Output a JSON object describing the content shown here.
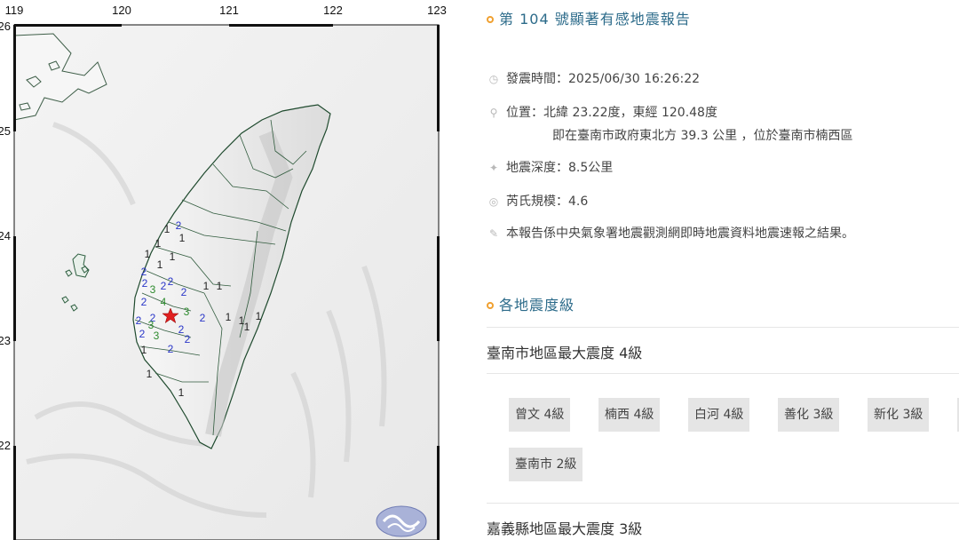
{
  "map": {
    "lon_labels": [
      "119",
      "120",
      "121",
      "122",
      "123"
    ],
    "lat_labels": [
      "26",
      "25",
      "24",
      "23",
      "22"
    ],
    "epicenter_symbol": "star",
    "intensity_marks": [
      {
        "v": "2",
        "c": "#2a36c8"
      },
      {
        "v": "1",
        "c": "#222"
      },
      {
        "v": "1",
        "c": "#222"
      },
      {
        "v": "1",
        "c": "#222"
      },
      {
        "v": "1",
        "c": "#222"
      },
      {
        "v": "1",
        "c": "#222"
      },
      {
        "v": "1",
        "c": "#222"
      },
      {
        "v": "2",
        "c": "#2a36c8"
      },
      {
        "v": "2",
        "c": "#2a36c8"
      },
      {
        "v": "2",
        "c": "#2a36c8"
      },
      {
        "v": "3",
        "c": "#2e8b2e"
      },
      {
        "v": "2",
        "c": "#2a36c8"
      },
      {
        "v": "2",
        "c": "#2a36c8"
      },
      {
        "v": "1",
        "c": "#222"
      },
      {
        "v": "1",
        "c": "#222"
      },
      {
        "v": "2",
        "c": "#2a36c8"
      },
      {
        "v": "4",
        "c": "#2e8b2e"
      },
      {
        "v": "2",
        "c": "#2a36c8"
      },
      {
        "v": "3",
        "c": "#2e8b2e"
      },
      {
        "v": "2",
        "c": "#2a36c8"
      },
      {
        "v": "3",
        "c": "#2e8b2e"
      },
      {
        "v": "2",
        "c": "#2a36c8"
      },
      {
        "v": "2",
        "c": "#2a36c8"
      },
      {
        "v": "3",
        "c": "#2e8b2e"
      },
      {
        "v": "2",
        "c": "#2a36c8"
      },
      {
        "v": "2",
        "c": "#2a36c8"
      },
      {
        "v": "1",
        "c": "#222"
      },
      {
        "v": "2",
        "c": "#2a36c8"
      },
      {
        "v": "1",
        "c": "#222"
      },
      {
        "v": "1",
        "c": "#222"
      },
      {
        "v": "1",
        "c": "#222"
      },
      {
        "v": "1",
        "c": "#222"
      },
      {
        "v": "1",
        "c": "#222"
      },
      {
        "v": "1",
        "c": "#222"
      }
    ]
  },
  "report": {
    "title": "第 104 號顯著有感地震報告",
    "origin_time": "發震時間：2025/06/30 16:26:22",
    "location": "位置：北緯 23.22度，東經 120.48度",
    "location_detail": "即在臺南市政府東北方 39.3 公里 ，位於臺南市楠西區",
    "depth": "地震深度：8.5公里",
    "magnitude": "芮氏規模：4.6",
    "note": "本報告係中央氣象署地震觀測網即時地震資料地震速報之結果。"
  },
  "intensity_section": {
    "title": "各地震度級",
    "regions": [
      {
        "heading": "臺南市地區最大震度 4級",
        "stations": [
          "曾文 4級",
          "楠西 4級",
          "白河 4級",
          "善化 3級",
          "新化 3級",
          "",
          "臺南市 2級"
        ]
      },
      {
        "heading": "嘉義縣地區最大震度 3級"
      }
    ]
  },
  "colors": {
    "title_blue": "#2c6b8a",
    "bullet_orange": "#f0a030",
    "intensity_1": "#222222",
    "intensity_2": "#2a36c8",
    "intensity_3_4": "#2e8b2e",
    "epicenter": "#e02020"
  },
  "icons": [
    "clock-icon",
    "map-pin-icon",
    "depth-icon",
    "magnitude-icon",
    "note-pen-icon"
  ]
}
